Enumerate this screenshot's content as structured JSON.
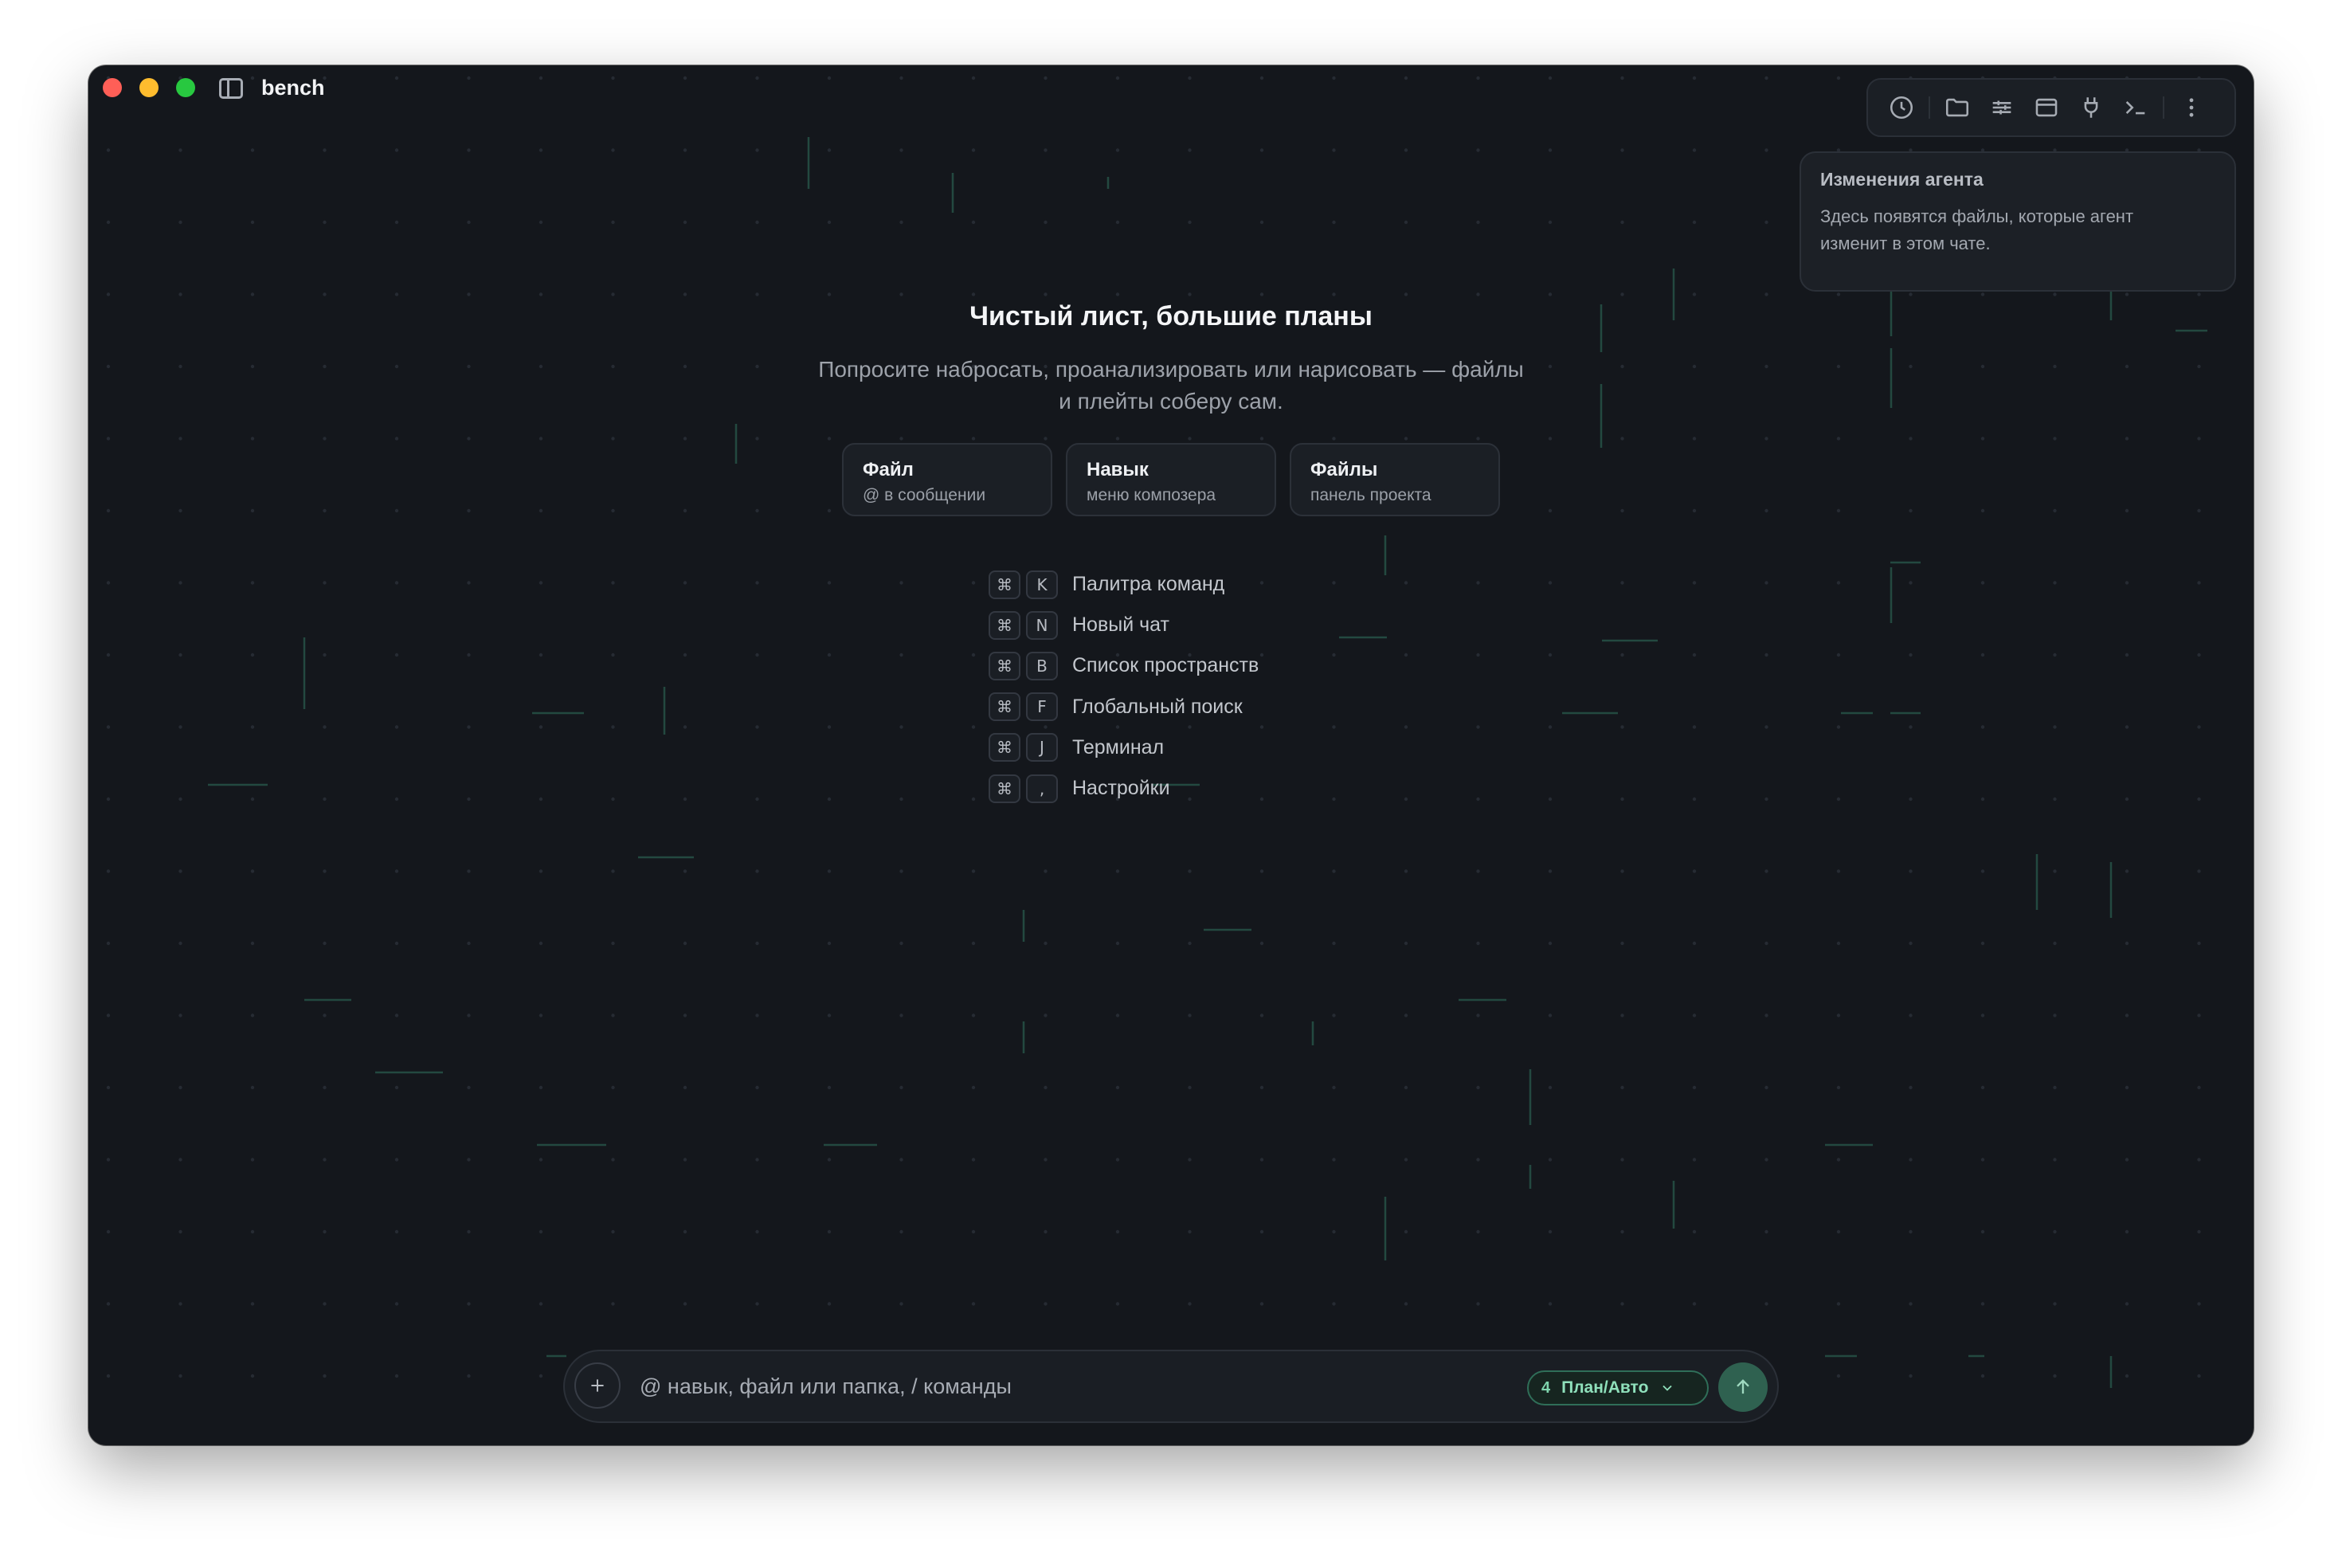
{
  "window": {
    "title": "bench"
  },
  "toolbar": {
    "icons": [
      "clock-icon",
      "folder-icon",
      "sliders-icon",
      "browser-window-icon",
      "plug-icon",
      "terminal-icon",
      "more-vertical-icon"
    ]
  },
  "agent_panel": {
    "title": "Изменения агента",
    "text": "Здесь появятся файлы, которые агент изменит в этом чате."
  },
  "hero": {
    "title": "Чистый лист, большие планы",
    "subtitle": "Попросите набросать, проанализировать или нарисовать — файлы и плейты соберу сам."
  },
  "cards": [
    {
      "title": "Файл",
      "subtitle": "@ в сообщении"
    },
    {
      "title": "Навык",
      "subtitle": "меню композера"
    },
    {
      "title": "Файлы",
      "subtitle": "панель проекта"
    }
  ],
  "shortcuts": [
    {
      "mod": "⌘",
      "key": "K",
      "label": "Палитра команд"
    },
    {
      "mod": "⌘",
      "key": "N",
      "label": "Новый чат"
    },
    {
      "mod": "⌘",
      "key": "B",
      "label": "Список пространств"
    },
    {
      "mod": "⌘",
      "key": "F",
      "label": "Глобальный поиск"
    },
    {
      "mod": "⌘",
      "key": "J",
      "label": "Терминал"
    },
    {
      "mod": "⌘",
      "key": ",",
      "label": "Настройки"
    }
  ],
  "composer": {
    "placeholder": "@ навык, файл или папка, / команды",
    "mode_count": "4",
    "mode_label": "План/Авто"
  },
  "colors": {
    "window_bg": "#14171c",
    "accent": "#2f6150",
    "grid_line": "#2e6b58"
  }
}
